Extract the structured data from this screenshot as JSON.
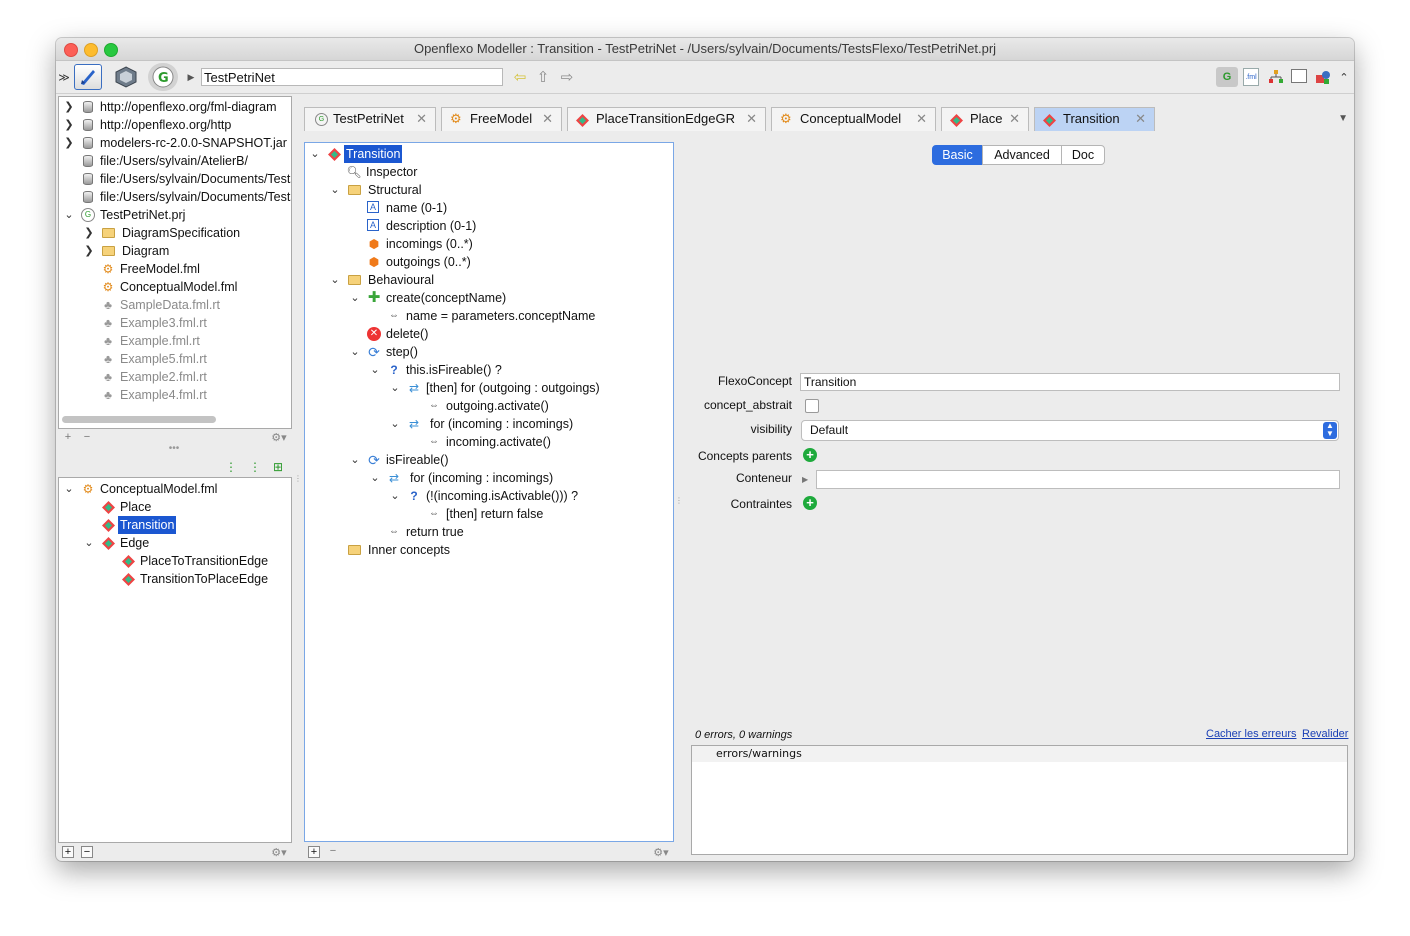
{
  "window": {
    "title": "Openflexo Modeller : Transition - TestPetriNet - /Users/sylvain/Documents/TestsFlexo/TestPetriNet.prj"
  },
  "toolbar": {
    "path_value": "TestPetriNet"
  },
  "resource_tree": {
    "items": [
      {
        "label": "http://openflexo.org/fml-diagram"
      },
      {
        "label": "http://openflexo.org/http"
      },
      {
        "label": "modelers-rc-2.0.0-SNAPSHOT.jar"
      },
      {
        "label": "file:/Users/sylvain/AtelierB/"
      },
      {
        "label": "file:/Users/sylvain/Documents/TestsFlexo"
      },
      {
        "label": "file:/Users/sylvain/Documents/TestsFlexo"
      },
      {
        "label": "TestPetriNet.prj"
      },
      {
        "label": "DiagramSpecification"
      },
      {
        "label": "Diagram"
      },
      {
        "label": "FreeModel.fml"
      },
      {
        "label": "ConceptualModel.fml"
      },
      {
        "label": "SampleData.fml.rt"
      },
      {
        "label": "Example3.fml.rt"
      },
      {
        "label": "Example.fml.rt"
      },
      {
        "label": "Example5.fml.rt"
      },
      {
        "label": "Example2.fml.rt"
      },
      {
        "label": "Example4.fml.rt"
      }
    ]
  },
  "model_tree": {
    "items": [
      {
        "label": "ConceptualModel.fml"
      },
      {
        "label": "Place"
      },
      {
        "label": "Transition"
      },
      {
        "label": "Edge"
      },
      {
        "label": "PlaceToTransitionEdge"
      },
      {
        "label": "TransitionToPlaceEdge"
      }
    ]
  },
  "tabs": [
    {
      "label": "TestPetriNet"
    },
    {
      "label": "FreeModel"
    },
    {
      "label": "PlaceTransitionEdgeGR"
    },
    {
      "label": "ConceptualModel"
    },
    {
      "label": "Place"
    },
    {
      "label": "Transition"
    }
  ],
  "concept_tree": {
    "items": [
      {
        "label": "Transition"
      },
      {
        "label": "Inspector"
      },
      {
        "label": "Structural"
      },
      {
        "label": "name (0-1)"
      },
      {
        "label": "description (0-1)"
      },
      {
        "label": "incomings (0..*)"
      },
      {
        "label": "outgoings (0..*)"
      },
      {
        "label": "Behavioural"
      },
      {
        "label": "create(conceptName)"
      },
      {
        "label": "name = parameters.conceptName"
      },
      {
        "label": "delete()"
      },
      {
        "label": "step()"
      },
      {
        "label": "this.isFireable() ?"
      },
      {
        "label": "[then]  for (outgoing : outgoings)"
      },
      {
        "label": "outgoing.activate()"
      },
      {
        "label": "for (incoming : incomings)"
      },
      {
        "label": "incoming.activate()"
      },
      {
        "label": "isFireable()"
      },
      {
        "label": "for (incoming : incomings)"
      },
      {
        "label": "(!(incoming.isActivable())) ?"
      },
      {
        "label": "[then] return false"
      },
      {
        "label": "return true"
      },
      {
        "label": "Inner concepts"
      }
    ]
  },
  "inspector": {
    "segments": [
      {
        "label": "Basic"
      },
      {
        "label": "Advanced"
      },
      {
        "label": "Doc"
      }
    ],
    "labels": {
      "flexo_concept": "FlexoConcept",
      "concept_abstrait": "concept_abstrait",
      "visibility": "visibility",
      "concepts_parents": "Concepts parents",
      "conteneur": "Conteneur",
      "contraintes": "Contraintes"
    },
    "values": {
      "flexo_concept": "Transition",
      "visibility": "Default",
      "conteneur": ""
    }
  },
  "validation": {
    "summary": "0 errors, 0 warnings",
    "hide_errors_link": "Cacher les erreurs",
    "revalidate_link": "Revalider",
    "column_header": "errors/warnings"
  },
  "colors": {
    "selection": "#1b57d1",
    "active_tab": "#bcd3f4",
    "segment_active": "#2d6cdf",
    "green_add": "#1eaa3c"
  }
}
